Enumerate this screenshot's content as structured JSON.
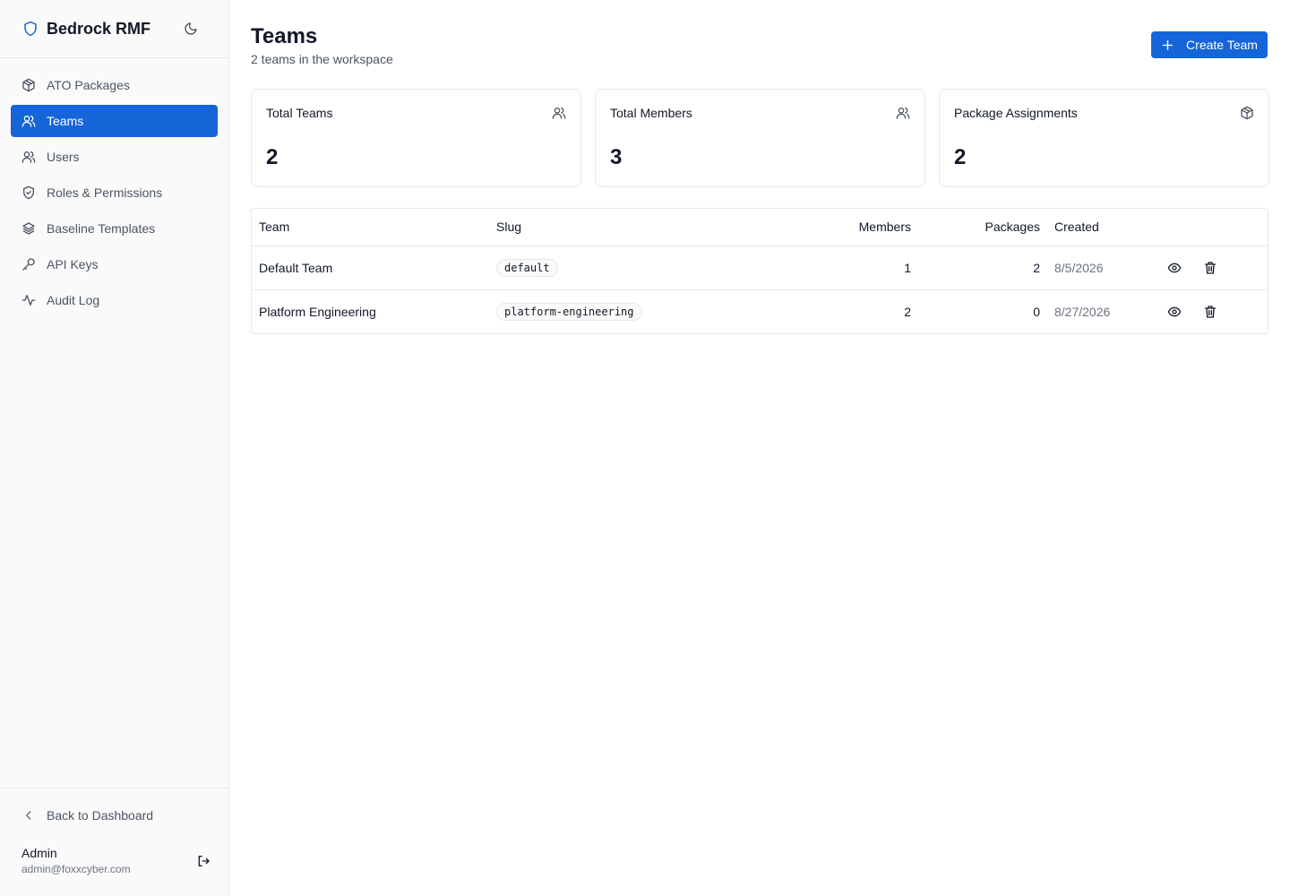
{
  "app": {
    "name": "Bedrock RMF"
  },
  "sidebar": {
    "items": [
      {
        "label": "ATO Packages",
        "icon": "package-icon"
      },
      {
        "label": "Teams",
        "icon": "team-icon",
        "active": true
      },
      {
        "label": "Users",
        "icon": "users-icon"
      },
      {
        "label": "Roles & Permissions",
        "icon": "shield-check-icon"
      },
      {
        "label": "Baseline Templates",
        "icon": "layers-icon"
      },
      {
        "label": "API Keys",
        "icon": "key-icon"
      },
      {
        "label": "Audit Log",
        "icon": "activity-icon"
      }
    ],
    "back_label": "Back to Dashboard",
    "user": {
      "name": "Admin",
      "email": "admin@foxxcyber.com"
    }
  },
  "header": {
    "title": "Teams",
    "subtitle": "2 teams in the workspace",
    "create_label": "Create Team"
  },
  "stats": [
    {
      "label": "Total Teams",
      "value": "2",
      "icon": "team-icon"
    },
    {
      "label": "Total Members",
      "value": "3",
      "icon": "users-icon"
    },
    {
      "label": "Package Assignments",
      "value": "2",
      "icon": "package-icon"
    }
  ],
  "table": {
    "columns": {
      "team": "Team",
      "slug": "Slug",
      "members": "Members",
      "packages": "Packages",
      "created": "Created"
    },
    "rows": [
      {
        "team": "Default Team",
        "slug": "default",
        "members": "1",
        "packages": "2",
        "created": "8/5/2026"
      },
      {
        "team": "Platform Engineering",
        "slug": "platform-engineering",
        "members": "2",
        "packages": "0",
        "created": "8/27/2026"
      }
    ]
  },
  "colors": {
    "accent": "#1565d8",
    "border": "#e5e7eb",
    "sidebar_bg": "#fafafa",
    "muted_text": "#4b5563"
  }
}
